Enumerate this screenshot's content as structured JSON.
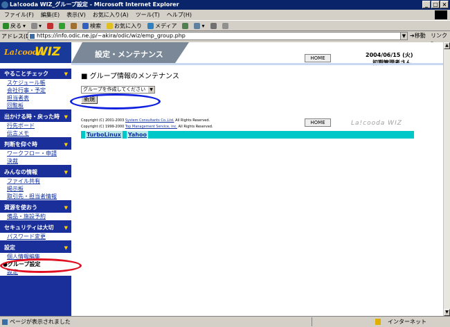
{
  "window": {
    "title": "La!cooda WIZ_グループ設定 - Microsoft Internet Explorer",
    "buttons": [
      "_",
      "□",
      "×"
    ]
  },
  "menu": [
    "ファイル(F)",
    "編集(E)",
    "表示(V)",
    "お気に入り(A)",
    "ツール(T)",
    "ヘルプ(H)"
  ],
  "toolbar": {
    "back": "戻る",
    "search": "検索",
    "favorites": "お気に入り",
    "media": "メディア"
  },
  "address": {
    "label": "アドレス(D)",
    "url": "https://info.odic.ne.jp/~akira/odic/wiz/emp_group.php",
    "go": "移動",
    "links": "リンク"
  },
  "header": {
    "logo_a": "La!cooda",
    "logo_b": "WIZ",
    "banner": "設定・メンテナンス",
    "home": "HOME",
    "date": "2004/06/15 (火)",
    "user": "初期管理者さん"
  },
  "sidebar": [
    {
      "section": "やることチェック",
      "items": [
        "スケジュール帳",
        "会社行事・予定",
        "担当者表",
        "回覧板"
      ]
    },
    {
      "section": "出かける時・戻った時",
      "items": [
        "行先ボード",
        "伝言メモ"
      ]
    },
    {
      "section": "判断を仰ぐ時",
      "items": [
        "ワークフロー・申請",
        "決裁"
      ]
    },
    {
      "section": "みんなの情報",
      "items": [
        "ファイル共有",
        "掲示板",
        "取引先・担当者情報"
      ]
    },
    {
      "section": "資源を使おう",
      "items": [
        "備品・施設予約"
      ]
    },
    {
      "section": "セキュリティは大切",
      "items": [
        "パスワード変更"
      ]
    },
    {
      "section": "設定",
      "items": [
        "個人情報編集",
        "グループ設定",
        "設定"
      ]
    }
  ],
  "main": {
    "title": "グループ情報のメンテナンス",
    "select_value": "グループを作成してください",
    "new_button": "新規",
    "copyright1": "Copyright (C) 2001-2003 ",
    "copyright1_link": "System Consultants Co.,Ltd.",
    "copyright1_end": " All Rights Reserved.",
    "copyright2": "Copyright (C) 1999-2000 ",
    "copyright2_link": "Top Management Service, inc.",
    "copyright2_end": " All Rights Reserved.",
    "home": "HOME",
    "brand": "La!cooda WIZ",
    "links": [
      "TurboLinux",
      "Yahoo"
    ]
  },
  "status": {
    "text": "ページが表示されました",
    "zone": "インターネット"
  },
  "colors": {
    "sidebar_bg": "#1a2f9a",
    "link_bar": "#00c8c8",
    "annotation_red": "#e01020",
    "annotation_blue": "#1020e0"
  }
}
